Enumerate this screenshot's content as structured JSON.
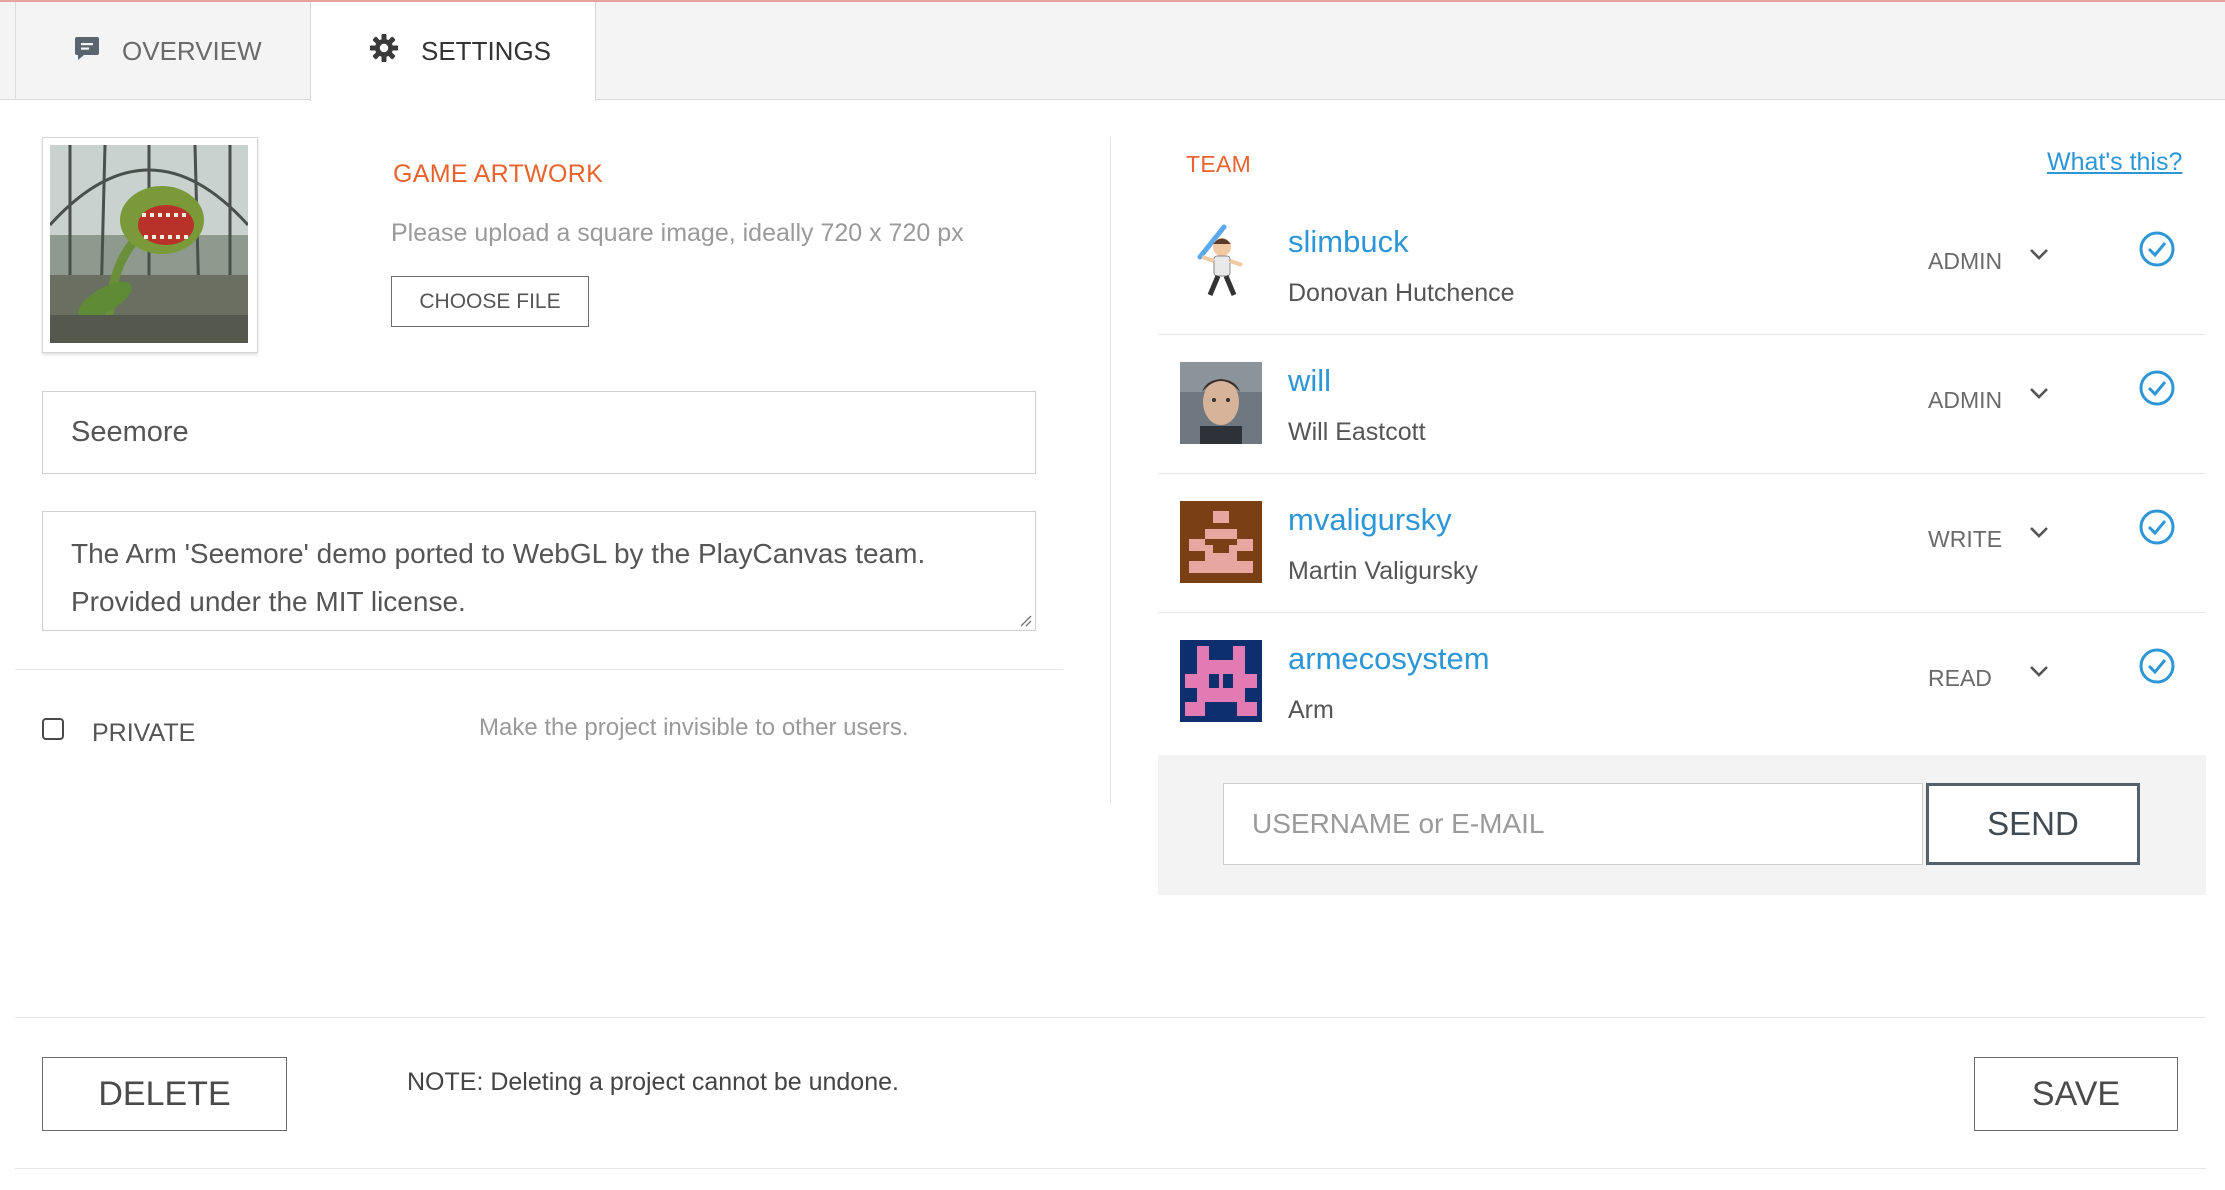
{
  "tabs": [
    {
      "label": "OVERVIEW",
      "icon": "speech-bubble-icon",
      "active": false
    },
    {
      "label": "SETTINGS",
      "icon": "gear-icon",
      "active": true
    }
  ],
  "artwork": {
    "title": "GAME ARTWORK",
    "hint": "Please upload a square image, ideally 720 x 720 px",
    "choose_label": "CHOOSE FILE"
  },
  "project": {
    "name": "Seemore",
    "description": "The Arm 'Seemore' demo ported to WebGL by the PlayCanvas team. Provided under the MIT license.",
    "private_label": "PRIVATE",
    "private_checked": false,
    "private_hint": "Make the project invisible to other users."
  },
  "team": {
    "title": "TEAM",
    "help_link": "What's this?",
    "members": [
      {
        "username": "slimbuck",
        "name": "Donovan Hutchence",
        "role": "ADMIN"
      },
      {
        "username": "will",
        "name": "Will Eastcott",
        "role": "ADMIN"
      },
      {
        "username": "mvaligursky",
        "name": "Martin Valigursky",
        "role": "WRITE"
      },
      {
        "username": "armecosystem",
        "name": "Arm",
        "role": "READ"
      }
    ],
    "invite_placeholder": "USERNAME or E-MAIL",
    "send_label": "SEND"
  },
  "footer": {
    "delete_label": "DELETE",
    "note": "NOTE: Deleting a project cannot be undone.",
    "save_label": "SAVE"
  },
  "colors": {
    "accent_orange": "#e8632e",
    "link_blue": "#2c96d6"
  }
}
